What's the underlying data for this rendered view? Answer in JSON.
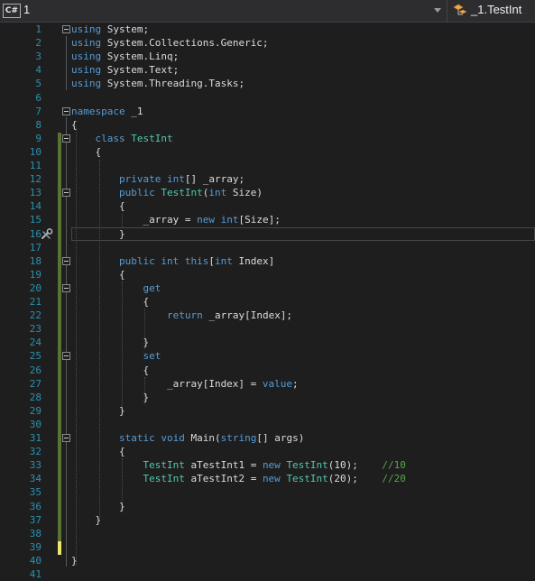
{
  "topbar": {
    "file_badge": "C#",
    "project_label": "1",
    "class_label": "_1.TestInt"
  },
  "icons": {
    "file": "csharp-file-icon",
    "dropdown": "chevron-down-icon",
    "class": "class-icon",
    "quick_action": "screwdriver-wrench-icon"
  },
  "colors": {
    "background": "#1e1e1e",
    "line_number": "#2b91af",
    "keyword": "#569cd6",
    "type": "#4ec9b0",
    "comment": "#57a64a",
    "text": "#dcdcdc",
    "change_saved": "#577430",
    "change_unsaved": "#e8e86b"
  },
  "editor": {
    "current_line": 16,
    "lines": [
      {
        "n": "1",
        "t": [
          {
            "k": "kw",
            "s": "using"
          },
          {
            "s": " System;"
          }
        ]
      },
      {
        "n": "2",
        "t": [
          {
            "k": "kw",
            "s": "using"
          },
          {
            "s": " System.Collections.Generic;"
          }
        ]
      },
      {
        "n": "3",
        "t": [
          {
            "k": "kw",
            "s": "using"
          },
          {
            "s": " System.Linq;"
          }
        ]
      },
      {
        "n": "4",
        "t": [
          {
            "k": "kw",
            "s": "using"
          },
          {
            "s": " System.Text;"
          }
        ]
      },
      {
        "n": "5",
        "t": [
          {
            "k": "kw",
            "s": "using"
          },
          {
            "s": " System.Threading.Tasks;"
          }
        ]
      },
      {
        "n": "6",
        "t": []
      },
      {
        "n": "7",
        "t": [
          {
            "k": "kw",
            "s": "namespace"
          },
          {
            "s": " _1"
          }
        ]
      },
      {
        "n": "8",
        "t": [
          {
            "s": "{"
          }
        ]
      },
      {
        "n": "9",
        "t": [
          {
            "s": "    "
          },
          {
            "k": "kw",
            "s": "class"
          },
          {
            "s": " "
          },
          {
            "k": "ty",
            "s": "TestInt"
          }
        ]
      },
      {
        "n": "10",
        "t": [
          {
            "s": "    {"
          }
        ]
      },
      {
        "n": "11",
        "t": []
      },
      {
        "n": "12",
        "t": [
          {
            "s": "        "
          },
          {
            "k": "kw",
            "s": "private"
          },
          {
            "s": " "
          },
          {
            "k": "kw",
            "s": "int"
          },
          {
            "s": "[] _array;"
          }
        ]
      },
      {
        "n": "13",
        "t": [
          {
            "s": "        "
          },
          {
            "k": "kw",
            "s": "public"
          },
          {
            "s": " "
          },
          {
            "k": "ty",
            "s": "TestInt"
          },
          {
            "s": "("
          },
          {
            "k": "kw",
            "s": "int"
          },
          {
            "s": " Size)"
          }
        ]
      },
      {
        "n": "14",
        "t": [
          {
            "s": "        {"
          }
        ]
      },
      {
        "n": "15",
        "t": [
          {
            "s": "            _array = "
          },
          {
            "k": "kw",
            "s": "new"
          },
          {
            "s": " "
          },
          {
            "k": "kw",
            "s": "int"
          },
          {
            "s": "[Size];"
          }
        ]
      },
      {
        "n": "16",
        "t": [
          {
            "s": "        }"
          }
        ]
      },
      {
        "n": "17",
        "t": []
      },
      {
        "n": "18",
        "t": [
          {
            "s": "        "
          },
          {
            "k": "kw",
            "s": "public"
          },
          {
            "s": " "
          },
          {
            "k": "kw",
            "s": "int"
          },
          {
            "s": " "
          },
          {
            "k": "kw",
            "s": "this"
          },
          {
            "s": "["
          },
          {
            "k": "kw",
            "s": "int"
          },
          {
            "s": " Index]"
          }
        ]
      },
      {
        "n": "19",
        "t": [
          {
            "s": "        {"
          }
        ]
      },
      {
        "n": "20",
        "t": [
          {
            "s": "            "
          },
          {
            "k": "kw",
            "s": "get"
          }
        ]
      },
      {
        "n": "21",
        "t": [
          {
            "s": "            {"
          }
        ]
      },
      {
        "n": "22",
        "t": [
          {
            "s": "                "
          },
          {
            "k": "kw",
            "s": "return"
          },
          {
            "s": " _array[Index];"
          }
        ]
      },
      {
        "n": "23",
        "t": []
      },
      {
        "n": "24",
        "t": [
          {
            "s": "            }"
          }
        ]
      },
      {
        "n": "25",
        "t": [
          {
            "s": "            "
          },
          {
            "k": "kw",
            "s": "set"
          }
        ]
      },
      {
        "n": "26",
        "t": [
          {
            "s": "            {"
          }
        ]
      },
      {
        "n": "27",
        "t": [
          {
            "s": "                _array[Index] = "
          },
          {
            "k": "kw",
            "s": "value"
          },
          {
            "s": ";"
          }
        ]
      },
      {
        "n": "28",
        "t": [
          {
            "s": "            }"
          }
        ]
      },
      {
        "n": "29",
        "t": [
          {
            "s": "        }"
          }
        ]
      },
      {
        "n": "30",
        "t": []
      },
      {
        "n": "31",
        "t": [
          {
            "s": "        "
          },
          {
            "k": "kw",
            "s": "static"
          },
          {
            "s": " "
          },
          {
            "k": "kw",
            "s": "void"
          },
          {
            "s": " Main("
          },
          {
            "k": "kw",
            "s": "string"
          },
          {
            "s": "[] args)"
          }
        ]
      },
      {
        "n": "32",
        "t": [
          {
            "s": "        {"
          }
        ]
      },
      {
        "n": "33",
        "t": [
          {
            "s": "            "
          },
          {
            "k": "ty",
            "s": "TestInt"
          },
          {
            "s": " aTestInt1 = "
          },
          {
            "k": "kw",
            "s": "new"
          },
          {
            "s": " "
          },
          {
            "k": "ty",
            "s": "TestInt"
          },
          {
            "s": "(10);    "
          },
          {
            "k": "cm",
            "s": "//10"
          }
        ]
      },
      {
        "n": "34",
        "t": [
          {
            "s": "            "
          },
          {
            "k": "ty",
            "s": "TestInt"
          },
          {
            "s": " aTestInt2 = "
          },
          {
            "k": "kw",
            "s": "new"
          },
          {
            "s": " "
          },
          {
            "k": "ty",
            "s": "TestInt"
          },
          {
            "s": "(20);    "
          },
          {
            "k": "cm",
            "s": "//20"
          }
        ]
      },
      {
        "n": "35",
        "t": []
      },
      {
        "n": "36",
        "t": [
          {
            "s": "        }"
          }
        ]
      },
      {
        "n": "37",
        "t": [
          {
            "s": "    }"
          }
        ]
      },
      {
        "n": "38",
        "t": []
      },
      {
        "n": "39",
        "t": []
      },
      {
        "n": "40",
        "t": [
          {
            "s": "}"
          }
        ]
      },
      {
        "n": "41",
        "t": []
      }
    ]
  }
}
